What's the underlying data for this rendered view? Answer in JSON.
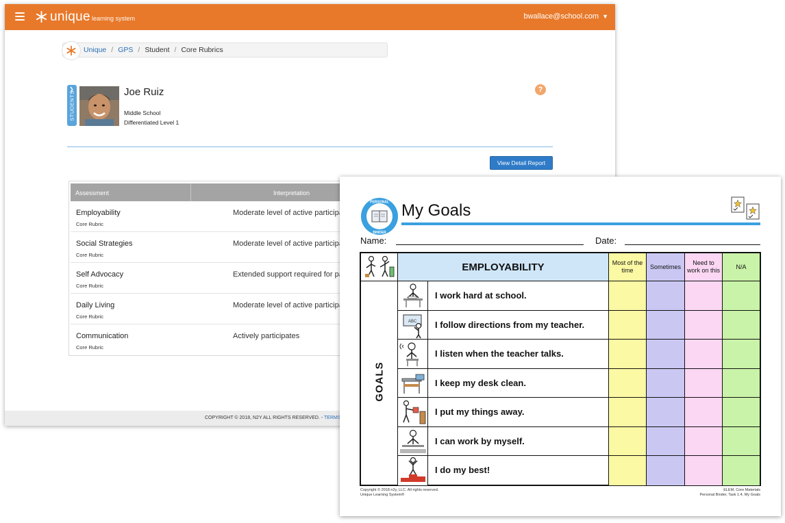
{
  "app": {
    "brand": "unique",
    "brand_sub": "learning system",
    "user_email": "bwallace@school.com",
    "accent_color": "#e8792a"
  },
  "breadcrumb": {
    "items": [
      "Unique",
      "GPS",
      "Student",
      "Core Rubrics"
    ]
  },
  "student": {
    "tab_label": "STUDENTS",
    "name": "Joe Ruiz",
    "school": "Middle School",
    "level": "Differentiated Level 1"
  },
  "actions": {
    "view_detail_report": "View Detail Report",
    "help": "?"
  },
  "table": {
    "headers": [
      "Assessment",
      "Interpretation"
    ],
    "rows": [
      {
        "name": "Employability",
        "sub": "Core Rubric",
        "interpretation": "Moderate level of active participa"
      },
      {
        "name": "Social Strategies",
        "sub": "Core Rubric",
        "interpretation": "Moderate level of active participa"
      },
      {
        "name": "Self Advocacy",
        "sub": "Core Rubric",
        "interpretation": "Extended support required for pa"
      },
      {
        "name": "Daily Living",
        "sub": "Core Rubric",
        "interpretation": "Moderate level of active participa"
      },
      {
        "name": "Communication",
        "sub": "Core Rubric",
        "interpretation": "Actively participates"
      }
    ]
  },
  "footer": {
    "copyright": "COPYRIGHT © 2018, N2Y ALL RIGHTS RESERVED. - ",
    "terms_link": "TERMS O"
  },
  "worksheet": {
    "badge_top": "PERSONAL",
    "badge_bottom": "BINDER",
    "title": "My Goals",
    "name_label": "Name:",
    "date_label": "Date:",
    "section": "EMPLOYABILITY",
    "side_label": "GOALS",
    "columns": [
      "Most of the time",
      "Sometimes",
      "Need to work on this",
      "N/A"
    ],
    "goals": [
      "I work hard at school.",
      "I follow directions from my teacher.",
      "I listen when the teacher talks.",
      "I keep my desk clean.",
      "I put my things away.",
      "I can work by myself.",
      "I do my best!"
    ],
    "footer_left_1": "Copyright © 2018 n2y, LLC. All rights reserved.",
    "footer_left_2": "Unique Learning System®",
    "footer_right_1": "ELEM, Core Materials",
    "footer_right_2": "Personal Binder, Task 1.4, My Goals",
    "column_colors": [
      "#fcf9a4",
      "#cac8f3",
      "#fbd7f4",
      "#c9f3a8"
    ]
  }
}
